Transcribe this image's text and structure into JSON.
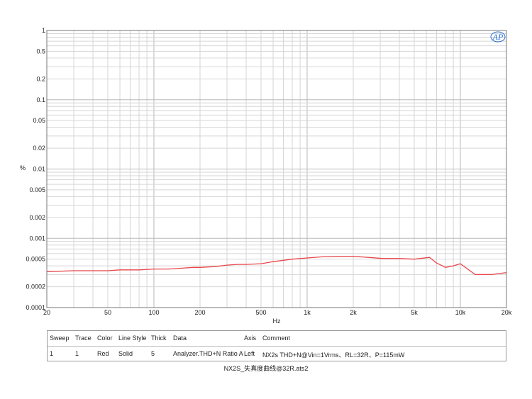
{
  "logo_text": "AP",
  "chart_data": {
    "type": "line",
    "xlabel": "Hz",
    "ylabel": "%",
    "x_scale": "log",
    "y_scale": "log",
    "xlim": [
      20,
      20000
    ],
    "ylim": [
      0.0001,
      1
    ],
    "grid": true,
    "x_ticks": [
      20,
      50,
      100,
      200,
      500,
      1000,
      2000,
      5000,
      10000,
      20000
    ],
    "x_tick_labels": [
      "20",
      "50",
      "100",
      "200",
      "500",
      "1k",
      "2k",
      "5k",
      "10k",
      "20k"
    ],
    "y_ticks": [
      1,
      0.5,
      0.2,
      0.1,
      0.05,
      0.02,
      0.01,
      0.005,
      0.002,
      0.001,
      0.0005,
      0.0002,
      0.0001
    ],
    "y_tick_labels": [
      "1",
      "0.5",
      "0.2",
      "0.1",
      "0.05",
      "0.02",
      "0.01",
      "0.005",
      "0.002",
      "0.001",
      "0.0005",
      "0.0002",
      "0.0001"
    ],
    "series": [
      {
        "color": "#e8464b",
        "x": [
          20,
          30,
          40,
          50,
          60,
          70,
          80,
          100,
          125,
          150,
          180,
          200,
          250,
          300,
          350,
          400,
          500,
          600,
          800,
          1000,
          1250,
          1600,
          2000,
          2500,
          3150,
          4000,
          5000,
          6300,
          7000,
          8000,
          9000,
          10000,
          12500,
          16000,
          20000
        ],
        "y": [
          0.00033,
          0.00034,
          0.00034,
          0.00034,
          0.00035,
          0.00035,
          0.00035,
          0.00036,
          0.00036,
          0.00037,
          0.00038,
          0.00038,
          0.00039,
          0.00041,
          0.00042,
          0.00042,
          0.00043,
          0.00046,
          0.0005,
          0.00052,
          0.00054,
          0.00055,
          0.00055,
          0.00053,
          0.00051,
          0.00051,
          0.0005,
          0.00053,
          0.00044,
          0.00038,
          0.0004,
          0.00043,
          0.0003,
          0.0003,
          0.00032
        ]
      }
    ]
  },
  "legend_table": {
    "headers": [
      "Sweep",
      "Trace",
      "Color",
      "Line Style",
      "Thick",
      "Data",
      "Axis",
      "Comment"
    ],
    "row": [
      "1",
      "1",
      "Red",
      "Solid",
      "5",
      "Analyzer.THD+N Ratio A",
      "Left",
      "NX2s THD+N@Vin=1Vrms、RL=32R、P=115mW"
    ]
  },
  "file_name": "NX2S_失真度曲线@32R.ats2"
}
